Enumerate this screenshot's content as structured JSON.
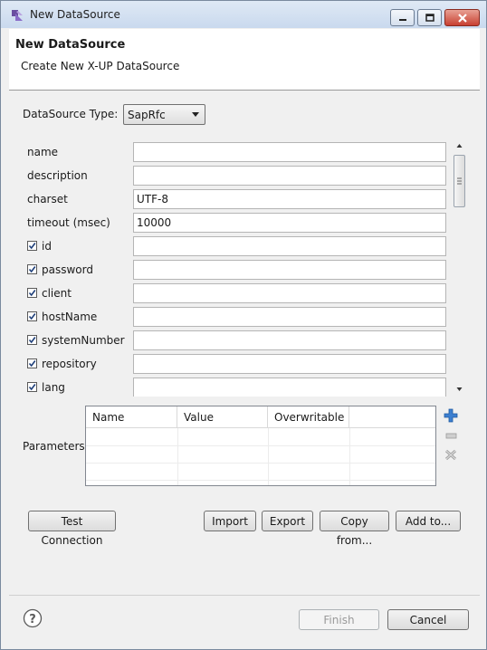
{
  "window": {
    "title": "New DataSource",
    "icons": {
      "app": "eclipse-app-icon",
      "minimize": "minimize-icon",
      "maximize": "maximize-icon",
      "close": "close-icon"
    }
  },
  "header": {
    "title": "New DataSource",
    "subtitle": "Create New X-UP DataSource"
  },
  "datasource_type": {
    "label": "DataSource Type:",
    "selected": "SapRfc"
  },
  "properties": [
    {
      "label": "name",
      "value": "",
      "checkbox": false
    },
    {
      "label": "description",
      "value": "",
      "checkbox": false
    },
    {
      "label": "charset",
      "value": "UTF-8",
      "checkbox": false
    },
    {
      "label": "timeout (msec)",
      "value": "10000",
      "checkbox": false
    },
    {
      "label": "id",
      "value": "",
      "checkbox": true,
      "checked": true
    },
    {
      "label": "password",
      "value": "",
      "checkbox": true,
      "checked": true
    },
    {
      "label": "client",
      "value": "",
      "checkbox": true,
      "checked": true
    },
    {
      "label": "hostName",
      "value": "",
      "checkbox": true,
      "checked": true
    },
    {
      "label": "systemNumber",
      "value": "",
      "checkbox": true,
      "checked": true
    },
    {
      "label": "repository",
      "value": "",
      "checkbox": true,
      "checked": true
    },
    {
      "label": "lang",
      "value": "",
      "checkbox": true,
      "checked": true
    }
  ],
  "parameters": {
    "label": "Parameters",
    "columns": [
      "Name",
      "Value",
      "Overwritable"
    ],
    "rows": [],
    "actions": {
      "add": "add-parameter-icon",
      "edit": "edit-parameter-icon",
      "remove": "remove-parameter-icon"
    }
  },
  "buttons": {
    "test_connection": "Test Connection",
    "import": "Import",
    "export": "Export",
    "copy_from": "Copy from...",
    "add_to": "Add to...",
    "finish": "Finish",
    "cancel": "Cancel"
  },
  "colors": {
    "accent": "#3c7fd0",
    "close_button": "#c84031"
  }
}
